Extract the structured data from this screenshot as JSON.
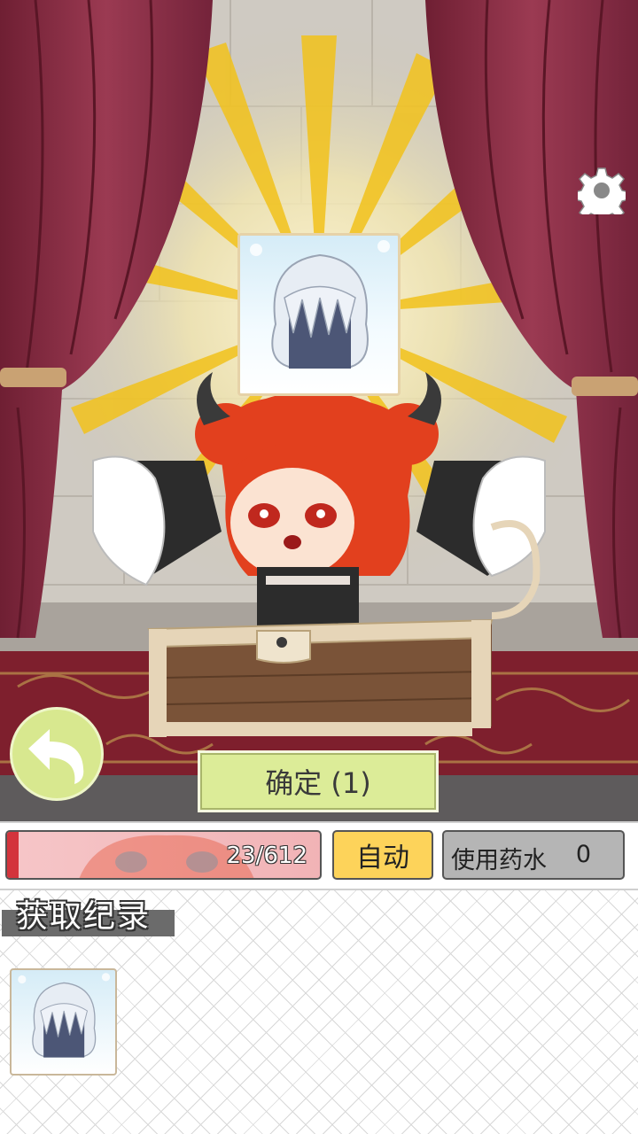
{
  "scene": {
    "item_name": "white-hair-item",
    "character": "red-haired-demon-girl-in-chest"
  },
  "buttons": {
    "confirm_label": "确定 (1)",
    "auto_label": "自动",
    "potion_label": "使用药水",
    "potion_count": "0"
  },
  "hp": {
    "text": "23/612",
    "current": 23,
    "max": 612
  },
  "record": {
    "title": "获取纪录",
    "items": [
      "white-hair-item"
    ]
  },
  "icons": {
    "settings": "gear-icon",
    "back": "back-arrow-icon"
  },
  "colors": {
    "confirm_bg": "#dcec98",
    "auto_bg": "#fdd35a",
    "potion_bg": "#b5b5b5",
    "hp_fill": "#d3343c",
    "curtain": "#8a2e45"
  }
}
